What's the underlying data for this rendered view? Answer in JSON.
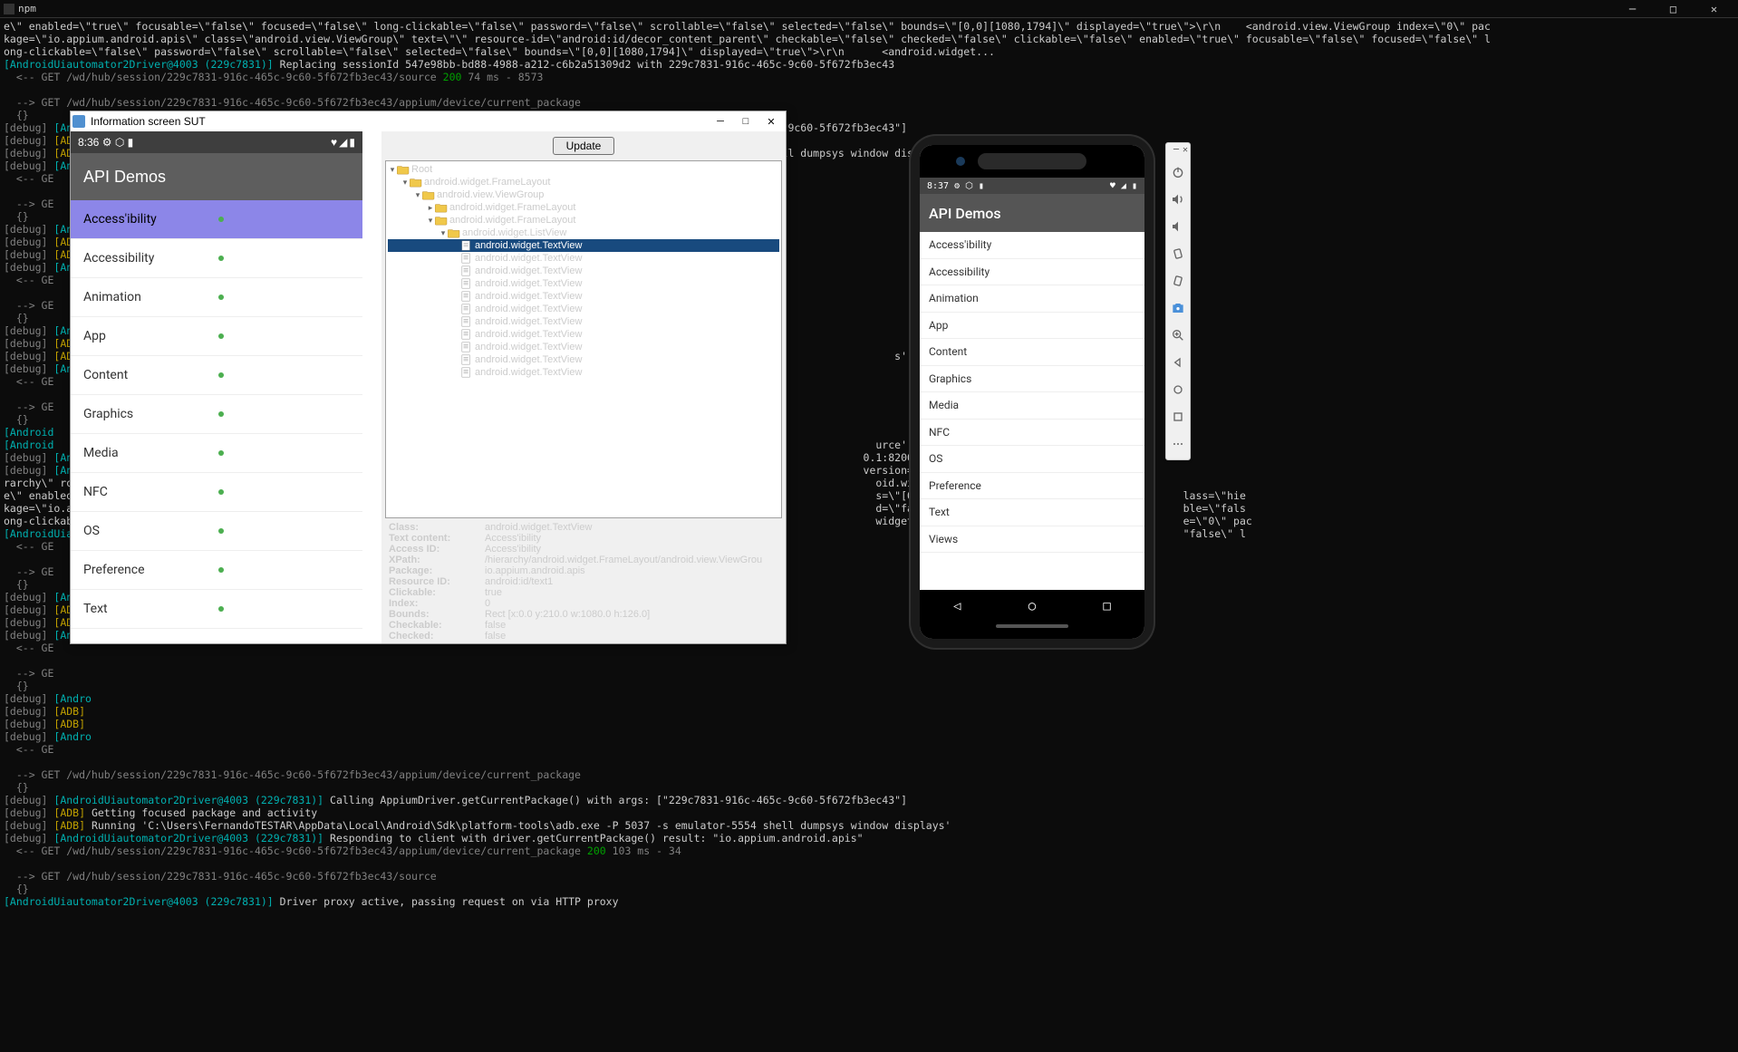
{
  "terminal": {
    "title": "npm",
    "lines": [
      {
        "segs": [
          {
            "c": "t-white",
            "t": "e\\\" enabled=\\\"true\\\" focusable=\\\"false\\\" focused=\\\"false\\\" long-clickable=\\\"false\\\" password=\\\"false\\\" scrollable=\\\"false\\\" selected=\\\"false\\\" bounds=\\\"[0,0][1080,1794]\\\" displayed=\\\"true\\\">\\r\\n    <android.view.ViewGroup index=\\\"0\\\" pac"
          }
        ]
      },
      {
        "segs": [
          {
            "c": "t-white",
            "t": "kage=\\\"io.appium.android.apis\\\" class=\\\"android.view.ViewGroup\\\" text=\\\"\\\" resource-id=\\\"android:id/decor_content_parent\\\" checkable=\\\"false\\\" checked=\\\"false\\\" clickable=\\\"false\\\" enabled=\\\"true\\\" focusable=\\\"false\\\" focused=\\\"false\\\" l"
          }
        ]
      },
      {
        "segs": [
          {
            "c": "t-white",
            "t": "ong-clickable=\\\"false\\\" password=\\\"false\\\" scrollable=\\\"false\\\" selected=\\\"false\\\" bounds=\\\"[0,0][1080,1794]\\\" displayed=\\\"true\\\">\\r\\n      <android.widget..."
          }
        ]
      },
      {
        "segs": [
          {
            "c": "t-cyan",
            "t": "[AndroidUiautomator2Driver@4003 (229c7831)]"
          },
          {
            "c": "t-white",
            "t": " Replacing sessionId 547e98bb-bd88-4988-a212-c6b2a51309d2 with 229c7831-916c-465c-9c60-5f672fb3ec43"
          }
        ]
      },
      {
        "segs": [
          {
            "c": "t-gray",
            "t": "  <-- GET /wd/hub/session/229c7831-916c-465c-9c60-5f672fb3ec43/source "
          },
          {
            "c": "t-green",
            "t": "200 "
          },
          {
            "c": "t-gray",
            "t": "74 ms - 8573"
          }
        ]
      },
      {
        "segs": [
          {
            "c": "t-white",
            "t": " "
          }
        ]
      },
      {
        "segs": [
          {
            "c": "t-gray",
            "t": "  --> GET /wd/hub/session/229c7831-916c-465c-9c60-5f672fb3ec43/appium/device/current_package"
          }
        ]
      },
      {
        "segs": [
          {
            "c": "t-gray",
            "t": "  {}"
          }
        ]
      },
      {
        "segs": [
          {
            "c": "t-gray",
            "t": "[debug] "
          },
          {
            "c": "t-cyan",
            "t": "[AndroidUiautomator2Driver@4003 (229c7831)]"
          },
          {
            "c": "t-white",
            "t": " Calling AppiumDriver.getCurrentPackage() with args: [\"229c7831-916c-465c-9c60-5f672fb3ec43\"]"
          }
        ]
      },
      {
        "segs": [
          {
            "c": "t-gray",
            "t": "[debug] "
          },
          {
            "c": "t-yellow",
            "t": "[ADB]"
          },
          {
            "c": "t-white",
            "t": " Getting focused package and activity"
          }
        ]
      },
      {
        "segs": [
          {
            "c": "t-gray",
            "t": "[debug] "
          },
          {
            "c": "t-yellow",
            "t": "[ADB]"
          },
          {
            "c": "t-white",
            "t": " Running 'C:\\Users\\FernandoTESTAR\\AppData\\Local\\Android\\Sdk\\platform-tools\\adb.exe -P 5037 -s emulator-5554 shell dumpsys window displays'"
          }
        ]
      },
      {
        "segs": [
          {
            "c": "t-gray",
            "t": "[debug] "
          },
          {
            "c": "t-cyan",
            "t": "[Andro"
          }
        ]
      },
      {
        "segs": [
          {
            "c": "t-gray",
            "t": "  <-- GE"
          }
        ]
      },
      {
        "segs": [
          {
            "c": "t-white",
            "t": " "
          }
        ]
      },
      {
        "segs": [
          {
            "c": "t-gray",
            "t": "  --> GE"
          }
        ]
      },
      {
        "segs": [
          {
            "c": "t-gray",
            "t": "  {}"
          }
        ]
      },
      {
        "segs": [
          {
            "c": "t-gray",
            "t": "[debug] "
          },
          {
            "c": "t-cyan",
            "t": "[Andro"
          }
        ]
      },
      {
        "segs": [
          {
            "c": "t-gray",
            "t": "[debug] "
          },
          {
            "c": "t-yellow",
            "t": "[ADB]"
          }
        ]
      },
      {
        "segs": [
          {
            "c": "t-gray",
            "t": "[debug] "
          },
          {
            "c": "t-yellow",
            "t": "[ADB]"
          }
        ]
      },
      {
        "segs": [
          {
            "c": "t-gray",
            "t": "[debug] "
          },
          {
            "c": "t-cyan",
            "t": "[Andro"
          }
        ]
      },
      {
        "segs": [
          {
            "c": "t-gray",
            "t": "  <-- GE"
          }
        ]
      },
      {
        "segs": [
          {
            "c": "t-white",
            "t": " "
          }
        ]
      },
      {
        "segs": [
          {
            "c": "t-gray",
            "t": "  --> GE"
          }
        ]
      },
      {
        "segs": [
          {
            "c": "t-gray",
            "t": "  {}"
          }
        ]
      },
      {
        "segs": [
          {
            "c": "t-gray",
            "t": "[debug] "
          },
          {
            "c": "t-cyan",
            "t": "[Andro"
          }
        ]
      },
      {
        "segs": [
          {
            "c": "t-gray",
            "t": "[debug] "
          },
          {
            "c": "t-yellow",
            "t": "[ADB]"
          }
        ]
      },
      {
        "segs": [
          {
            "c": "t-gray",
            "t": "[debug] "
          },
          {
            "c": "t-yellow",
            "t": "[ADB]"
          },
          {
            "c": "t-white",
            "t": "                                                                                                                                 s'"
          }
        ]
      },
      {
        "segs": [
          {
            "c": "t-gray",
            "t": "[debug] "
          },
          {
            "c": "t-cyan",
            "t": "[Andro"
          }
        ]
      },
      {
        "segs": [
          {
            "c": "t-gray",
            "t": "  <-- GE"
          }
        ]
      },
      {
        "segs": [
          {
            "c": "t-white",
            "t": " "
          }
        ]
      },
      {
        "segs": [
          {
            "c": "t-gray",
            "t": "  --> GE"
          }
        ]
      },
      {
        "segs": [
          {
            "c": "t-gray",
            "t": "  {}"
          }
        ]
      },
      {
        "segs": [
          {
            "c": "t-cyan",
            "t": "[Android"
          }
        ]
      },
      {
        "segs": [
          {
            "c": "t-cyan",
            "t": "[Android"
          },
          {
            "c": "t-white",
            "t": "                                                                                                                                   urce'"
          }
        ]
      },
      {
        "segs": [
          {
            "c": "t-gray",
            "t": "[debug] "
          },
          {
            "c": "t-cyan",
            "t": "[Andro"
          },
          {
            "c": "t-white",
            "t": "                                                                                                                           0.1:8200/session/547e98"
          }
        ]
      },
      {
        "segs": [
          {
            "c": "t-gray",
            "t": "[debug] "
          },
          {
            "c": "t-cyan",
            "t": "[Andro"
          },
          {
            "c": "t-white",
            "t": "                                                                                                                           version='1.0' encoding"
          }
        ]
      },
      {
        "segs": [
          {
            "c": "t-white",
            "t": "rarchy\\\" rota                                                                                                                              oid.widget.FrameLayout\\"
          }
        ]
      },
      {
        "segs": [
          {
            "c": "t-white",
            "t": "e\\\" enabled=\\                                                                                                                              s=\\\"[0,0][1080,1794]\\\"                           lass=\\\"hie"
          }
        ]
      },
      {
        "segs": [
          {
            "c": "t-white",
            "t": "kage=\\\"io.app                                                                                                                              d=\\\"false\\\" clickable=                           ble=\\\"fals"
          }
        ]
      },
      {
        "segs": [
          {
            "c": "t-white",
            "t": "ong-clickable                                                                                                                              widget...                                        e=\\\"0\\\" pac"
          }
        ]
      },
      {
        "segs": [
          {
            "c": "t-cyan",
            "t": "[AndroidUiaut"
          },
          {
            "c": "t-white",
            "t": "                                                                                                                                                                               \"false\\\" l"
          }
        ]
      },
      {
        "segs": [
          {
            "c": "t-gray",
            "t": "  <-- GE"
          }
        ]
      },
      {
        "segs": [
          {
            "c": "t-white",
            "t": " "
          }
        ]
      },
      {
        "segs": [
          {
            "c": "t-gray",
            "t": "  --> GE"
          }
        ]
      },
      {
        "segs": [
          {
            "c": "t-gray",
            "t": "  {}"
          }
        ]
      },
      {
        "segs": [
          {
            "c": "t-gray",
            "t": "[debug] "
          },
          {
            "c": "t-cyan",
            "t": "[Andro"
          }
        ]
      },
      {
        "segs": [
          {
            "c": "t-gray",
            "t": "[debug] "
          },
          {
            "c": "t-yellow",
            "t": "[ADB]"
          }
        ]
      },
      {
        "segs": [
          {
            "c": "t-gray",
            "t": "[debug] "
          },
          {
            "c": "t-yellow",
            "t": "[ADB]"
          }
        ]
      },
      {
        "segs": [
          {
            "c": "t-gray",
            "t": "[debug] "
          },
          {
            "c": "t-cyan",
            "t": "[Andro"
          }
        ]
      },
      {
        "segs": [
          {
            "c": "t-gray",
            "t": "  <-- GE"
          }
        ]
      },
      {
        "segs": [
          {
            "c": "t-white",
            "t": " "
          }
        ]
      },
      {
        "segs": [
          {
            "c": "t-gray",
            "t": "  --> GE"
          }
        ]
      },
      {
        "segs": [
          {
            "c": "t-gray",
            "t": "  {}"
          }
        ]
      },
      {
        "segs": [
          {
            "c": "t-gray",
            "t": "[debug] "
          },
          {
            "c": "t-cyan",
            "t": "[Andro"
          }
        ]
      },
      {
        "segs": [
          {
            "c": "t-gray",
            "t": "[debug] "
          },
          {
            "c": "t-yellow",
            "t": "[ADB]"
          }
        ]
      },
      {
        "segs": [
          {
            "c": "t-gray",
            "t": "[debug] "
          },
          {
            "c": "t-yellow",
            "t": "[ADB]"
          }
        ]
      },
      {
        "segs": [
          {
            "c": "t-gray",
            "t": "[debug] "
          },
          {
            "c": "t-cyan",
            "t": "[Andro"
          }
        ]
      },
      {
        "segs": [
          {
            "c": "t-gray",
            "t": "  <-- GE"
          }
        ]
      },
      {
        "segs": [
          {
            "c": "t-white",
            "t": " "
          }
        ]
      },
      {
        "segs": [
          {
            "c": "t-gray",
            "t": "  --> GET /wd/hub/session/229c7831-916c-465c-9c60-5f672fb3ec43/appium/device/current_package"
          }
        ]
      },
      {
        "segs": [
          {
            "c": "t-gray",
            "t": "  {}"
          }
        ]
      },
      {
        "segs": [
          {
            "c": "t-gray",
            "t": "[debug] "
          },
          {
            "c": "t-cyan",
            "t": "[AndroidUiautomator2Driver@4003 (229c7831)]"
          },
          {
            "c": "t-white",
            "t": " Calling AppiumDriver.getCurrentPackage() with args: [\"229c7831-916c-465c-9c60-5f672fb3ec43\"]"
          }
        ]
      },
      {
        "segs": [
          {
            "c": "t-gray",
            "t": "[debug] "
          },
          {
            "c": "t-yellow",
            "t": "[ADB]"
          },
          {
            "c": "t-white",
            "t": " Getting focused package and activity"
          }
        ]
      },
      {
        "segs": [
          {
            "c": "t-gray",
            "t": "[debug] "
          },
          {
            "c": "t-yellow",
            "t": "[ADB]"
          },
          {
            "c": "t-white",
            "t": " Running 'C:\\Users\\FernandoTESTAR\\AppData\\Local\\Android\\Sdk\\platform-tools\\adb.exe -P 5037 -s emulator-5554 shell dumpsys window displays'"
          }
        ]
      },
      {
        "segs": [
          {
            "c": "t-gray",
            "t": "[debug] "
          },
          {
            "c": "t-cyan",
            "t": "[AndroidUiautomator2Driver@4003 (229c7831)]"
          },
          {
            "c": "t-white",
            "t": " Responding to client with driver.getCurrentPackage() result: \"io.appium.android.apis\""
          }
        ]
      },
      {
        "segs": [
          {
            "c": "t-gray",
            "t": "  <-- GET /wd/hub/session/229c7831-916c-465c-9c60-5f672fb3ec43/appium/device/current_package "
          },
          {
            "c": "t-green",
            "t": "200 "
          },
          {
            "c": "t-gray",
            "t": "103 ms - 34"
          }
        ]
      },
      {
        "segs": [
          {
            "c": "t-white",
            "t": " "
          }
        ]
      },
      {
        "segs": [
          {
            "c": "t-gray",
            "t": "  --> GET /wd/hub/session/229c7831-916c-465c-9c60-5f672fb3ec43/source"
          }
        ]
      },
      {
        "segs": [
          {
            "c": "t-gray",
            "t": "  {}"
          }
        ]
      },
      {
        "segs": [
          {
            "c": "t-cyan",
            "t": "[AndroidUiautomator2Driver@4003 (229c7831)]"
          },
          {
            "c": "t-white",
            "t": " Driver proxy active, passing request on via HTTP proxy"
          }
        ]
      }
    ]
  },
  "sut": {
    "title": "Information screen SUT",
    "update_label": "Update",
    "device": {
      "time": "8:36",
      "app_title": "API Demos",
      "items": [
        {
          "label": "Access'ibility",
          "selected": true
        },
        {
          "label": "Accessibility"
        },
        {
          "label": "Animation"
        },
        {
          "label": "App"
        },
        {
          "label": "Content"
        },
        {
          "label": "Graphics"
        },
        {
          "label": "Media"
        },
        {
          "label": "NFC"
        },
        {
          "label": "OS"
        },
        {
          "label": "Preference"
        },
        {
          "label": "Text"
        }
      ]
    },
    "tree": [
      {
        "indent": 0,
        "toggle": "▾",
        "icon": "folder",
        "label": "Root"
      },
      {
        "indent": 1,
        "toggle": "▾",
        "icon": "folder",
        "label": "android.widget.FrameLayout"
      },
      {
        "indent": 2,
        "toggle": "▾",
        "icon": "folder",
        "label": "android.view.ViewGroup"
      },
      {
        "indent": 3,
        "toggle": "▸",
        "icon": "folder",
        "label": "android.widget.FrameLayout"
      },
      {
        "indent": 3,
        "toggle": "▾",
        "icon": "folder",
        "label": "android.widget.FrameLayout"
      },
      {
        "indent": 4,
        "toggle": "▾",
        "icon": "folder",
        "label": "android.widget.ListView"
      },
      {
        "indent": 5,
        "toggle": "",
        "icon": "file",
        "label": "android.widget.TextView",
        "selected": true
      },
      {
        "indent": 5,
        "toggle": "",
        "icon": "file",
        "label": "android.widget.TextView"
      },
      {
        "indent": 5,
        "toggle": "",
        "icon": "file",
        "label": "android.widget.TextView"
      },
      {
        "indent": 5,
        "toggle": "",
        "icon": "file",
        "label": "android.widget.TextView"
      },
      {
        "indent": 5,
        "toggle": "",
        "icon": "file",
        "label": "android.widget.TextView"
      },
      {
        "indent": 5,
        "toggle": "",
        "icon": "file",
        "label": "android.widget.TextView"
      },
      {
        "indent": 5,
        "toggle": "",
        "icon": "file",
        "label": "android.widget.TextView"
      },
      {
        "indent": 5,
        "toggle": "",
        "icon": "file",
        "label": "android.widget.TextView"
      },
      {
        "indent": 5,
        "toggle": "",
        "icon": "file",
        "label": "android.widget.TextView"
      },
      {
        "indent": 5,
        "toggle": "",
        "icon": "file",
        "label": "android.widget.TextView"
      },
      {
        "indent": 5,
        "toggle": "",
        "icon": "file",
        "label": "android.widget.TextView"
      }
    ],
    "details": [
      {
        "k": "Class:",
        "v": "android.widget.TextView"
      },
      {
        "k": "Text content:",
        "v": "Access'ibility"
      },
      {
        "k": "Access ID:",
        "v": "Access'ibility"
      },
      {
        "k": "XPath:",
        "v": "/hierarchy/android.widget.FrameLayout/android.view.ViewGrou"
      },
      {
        "k": "Package:",
        "v": "io.appium.android.apis"
      },
      {
        "k": "Resource ID:",
        "v": "android:id/text1"
      },
      {
        "k": "Clickable:",
        "v": "true"
      },
      {
        "k": "Index:",
        "v": "0"
      },
      {
        "k": "Bounds:",
        "v": "Rect [x:0.0 y:210.0 w:1080.0 h:126.0]"
      },
      {
        "k": "Checkable:",
        "v": "false"
      },
      {
        "k": "Checked:",
        "v": "false"
      }
    ]
  },
  "emulator": {
    "time": "8:37",
    "app_title": "API Demos",
    "items": [
      "Access'ibility",
      "Accessibility",
      "Animation",
      "App",
      "Content",
      "Graphics",
      "Media",
      "NFC",
      "OS",
      "Preference",
      "Text",
      "Views"
    ]
  },
  "toolbar": {
    "icons": [
      "power",
      "volume-up",
      "volume-down",
      "rotate-left",
      "rotate-right",
      "camera",
      "zoom",
      "back",
      "home",
      "overview",
      "more"
    ]
  }
}
